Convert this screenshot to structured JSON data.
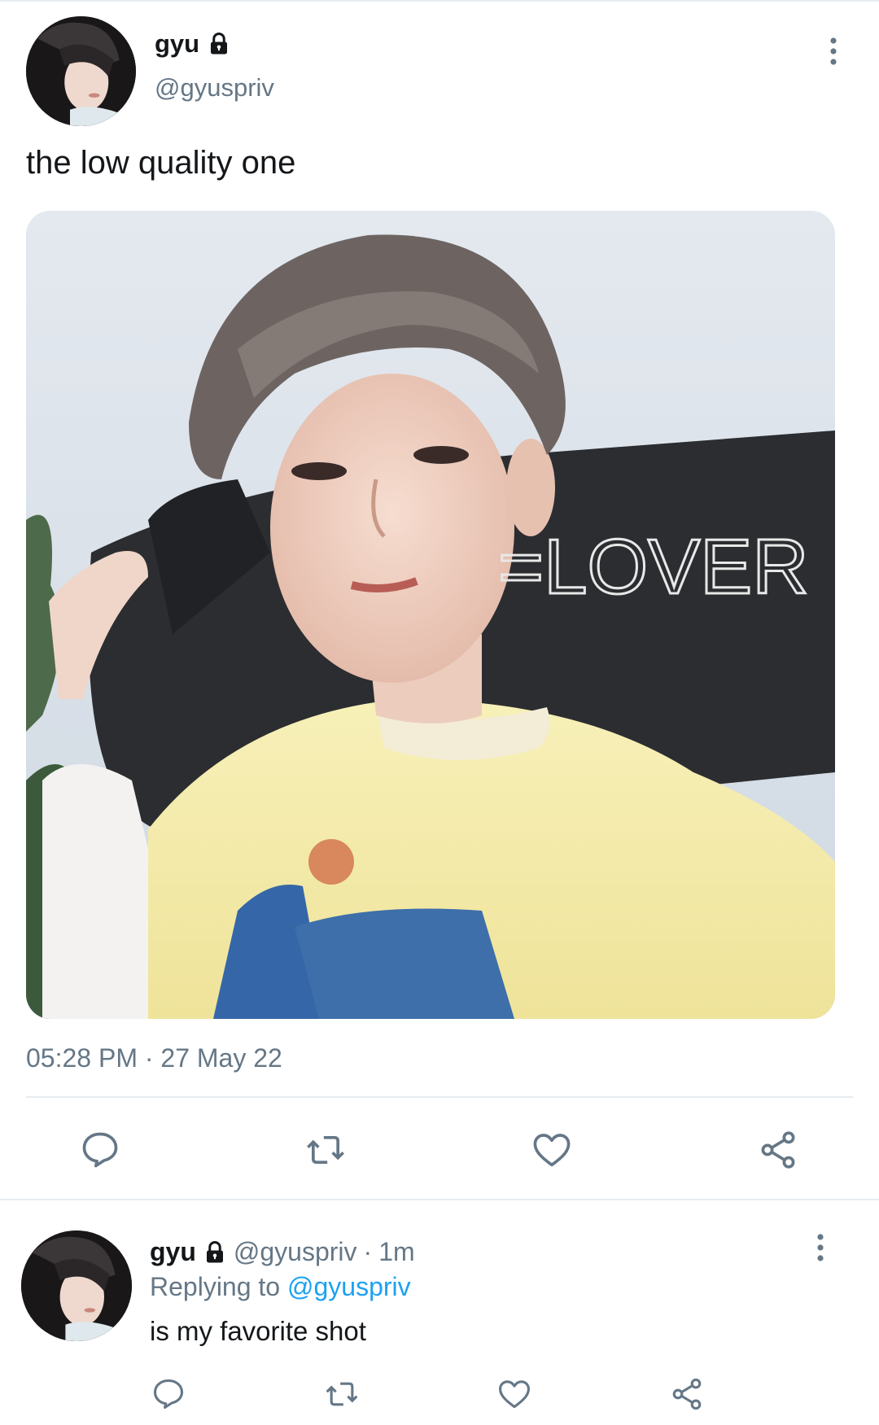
{
  "tweet": {
    "display_name": "gyu",
    "handle": "@gyuspriv",
    "text": "the low quality one",
    "media_overlay_text": "=LOVER",
    "timestamp": "05:28 PM · 27 May 22",
    "icons": [
      "lock-icon",
      "more-vertical-icon",
      "reply-icon",
      "retweet-icon",
      "like-icon",
      "share-icon"
    ]
  },
  "reply": {
    "display_name": "gyu",
    "handle": "@gyuspriv",
    "separator": "·",
    "time": "1m",
    "replying_prefix": "Replying to",
    "replying_to": "@gyuspriv",
    "text": "is my favorite shot"
  },
  "colors": {
    "text": "#14171a",
    "secondary": "#657786",
    "accent": "#1da1f2",
    "divider": "#e6ecf0"
  }
}
